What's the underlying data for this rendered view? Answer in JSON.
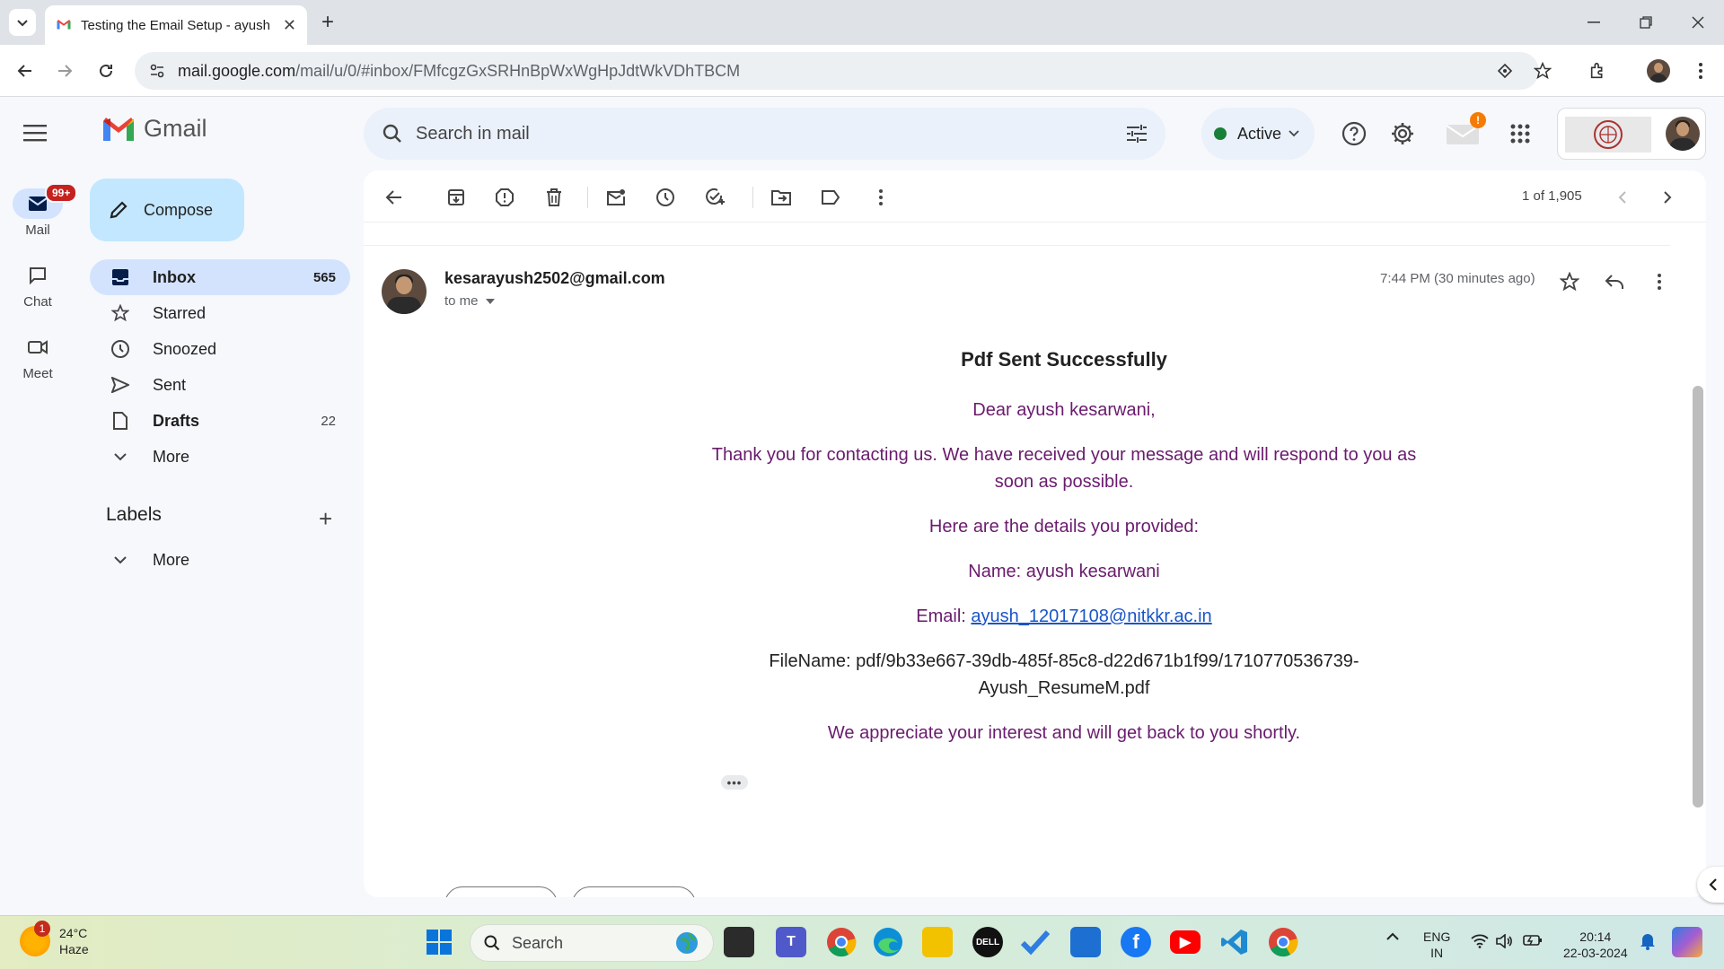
{
  "browser": {
    "tab_title": "Testing the Email Setup - ayush",
    "url_host": "mail.google.com",
    "url_path": "/mail/u/0/#inbox/FMfcgzGxSRHnBpWxWgHpJdtWkVDhTBCM"
  },
  "gmail": {
    "logo_text": "Gmail",
    "rail": {
      "mail_label": "Mail",
      "mail_badge": "99+",
      "chat_label": "Chat",
      "meet_label": "Meet"
    },
    "compose_label": "Compose",
    "nav": [
      {
        "label": "Inbox",
        "count": "565"
      },
      {
        "label": "Starred",
        "count": ""
      },
      {
        "label": "Snoozed",
        "count": ""
      },
      {
        "label": "Sent",
        "count": ""
      },
      {
        "label": "Drafts",
        "count": "22"
      },
      {
        "label": "More",
        "count": ""
      }
    ],
    "labels_heading": "Labels",
    "labels_more": "More",
    "search_placeholder": "Search in mail",
    "status": "Active",
    "notification_badge": "!"
  },
  "toolbar": {
    "pager": "1 of 1,905"
  },
  "message": {
    "sender": "kesarayush2502@gmail.com",
    "to": "to me",
    "time": "7:44 PM (30 minutes ago)",
    "heading": "Pdf Sent Successfully",
    "greeting": "Dear ayush kesarwani,",
    "para1": "Thank you for contacting us. We have received your message and will respond to you as soon as possible.",
    "para2": "Here are the details you provided:",
    "name_line": "Name: ayush kesarwani",
    "email_prefix": "Email: ",
    "email_link": "ayush_12017108@nitkkr.ac.in",
    "filename_line": "FileName: pdf/9b33e667-39db-485f-85c8-d22d671b1f99/1710770536739-Ayush_ResumeM.pdf",
    "closing": "We appreciate your interest and will get back to you shortly.",
    "ellipsis": "•••"
  },
  "taskbar": {
    "weather_temp": "24°C",
    "weather_desc": "Haze",
    "weather_badge": "1",
    "search_label": "Search",
    "lang_top": "ENG",
    "lang_bottom": "IN",
    "clock_time": "20:14",
    "clock_date": "22-03-2024"
  },
  "colors": {
    "accent": "#0b57d0",
    "compose_bg": "#c2e7ff",
    "nav_active": "#d3e3fd",
    "body_purple": "#6a1b6e",
    "status_green": "#188038"
  }
}
